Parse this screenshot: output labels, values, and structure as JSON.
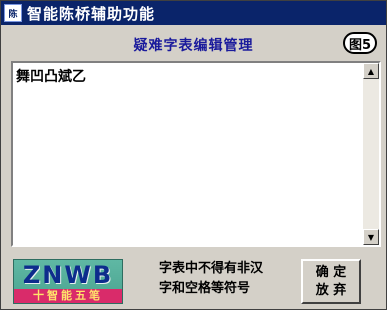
{
  "window": {
    "icon_text": "陈",
    "title": "智能陈桥辅助功能"
  },
  "dialog": {
    "heading": "疑难字表编辑管理",
    "figure_badge": "图5"
  },
  "editor": {
    "content": "舞凹凸斌乙"
  },
  "logo": {
    "top_text": "ZNWB",
    "bottom_text": "十智能五笔"
  },
  "notice": {
    "line1": "字表中不得有非汉",
    "line2": "字和空格等符号"
  },
  "buttons": {
    "ok_line1": "确 定",
    "ok_line2": "放 弃"
  },
  "colors": {
    "titlebar": "#0a246a",
    "heading": "#1a1a9c",
    "logo_bg": "#5fb8a4",
    "logo_band": "#d92b6a"
  }
}
